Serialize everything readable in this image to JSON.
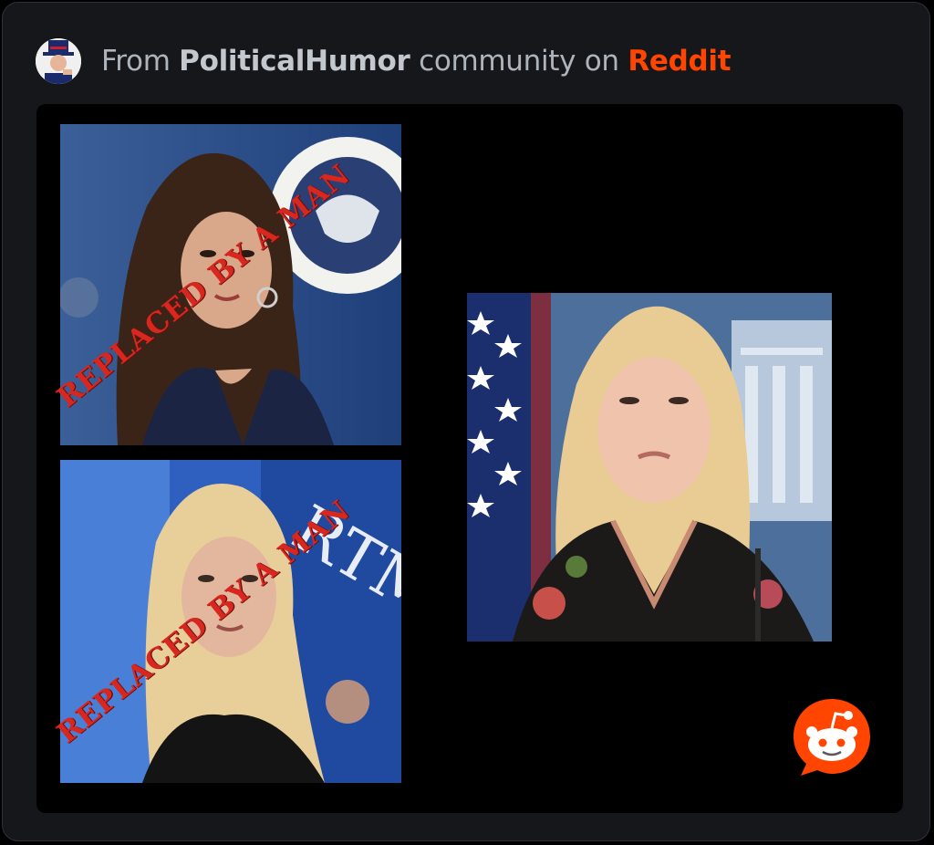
{
  "header": {
    "prefix": "From",
    "community": "PoliticalHumor",
    "middle": "community on",
    "platform": "Reddit"
  },
  "images": [
    {
      "stamp_text": "REPLACED BY A MAN"
    },
    {
      "stamp_text": "REPLACED BY A MAN"
    },
    {
      "stamp_text": ""
    }
  ],
  "icons": {
    "avatar": "uncle-sam-avatar-icon",
    "logo": "reddit-logo-icon"
  },
  "colors": {
    "brand": "#ff4500",
    "card_bg": "#15171b",
    "stamp": "#d7271f"
  }
}
